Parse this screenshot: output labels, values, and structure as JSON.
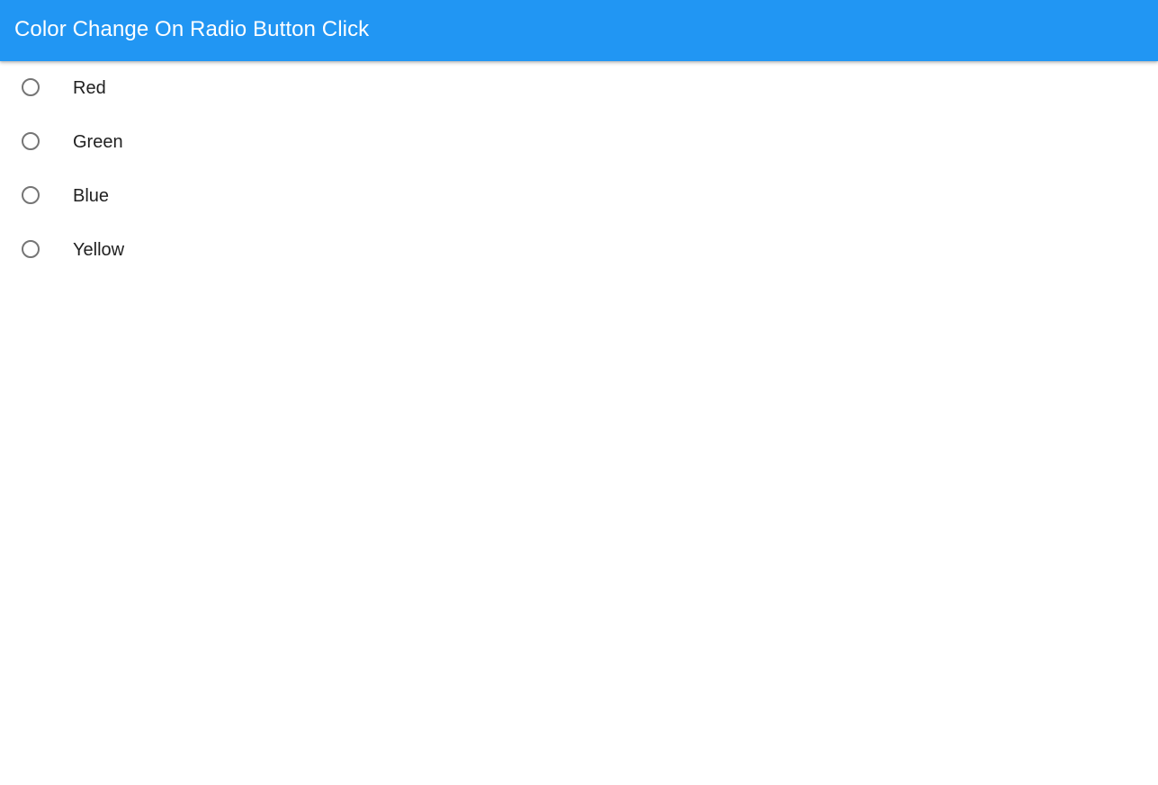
{
  "app_bar": {
    "title": "Color Change On Radio Button Click",
    "background_color": "#2196F3",
    "title_color": "#FFFFFF"
  },
  "radio_group": {
    "options": [
      {
        "label": "Red",
        "selected": false
      },
      {
        "label": "Green",
        "selected": false
      },
      {
        "label": "Blue",
        "selected": false
      },
      {
        "label": "Yellow",
        "selected": false
      }
    ],
    "ring_color": "#757575",
    "label_color": "#212121"
  },
  "page": {
    "background_color": "#FFFFFF"
  }
}
